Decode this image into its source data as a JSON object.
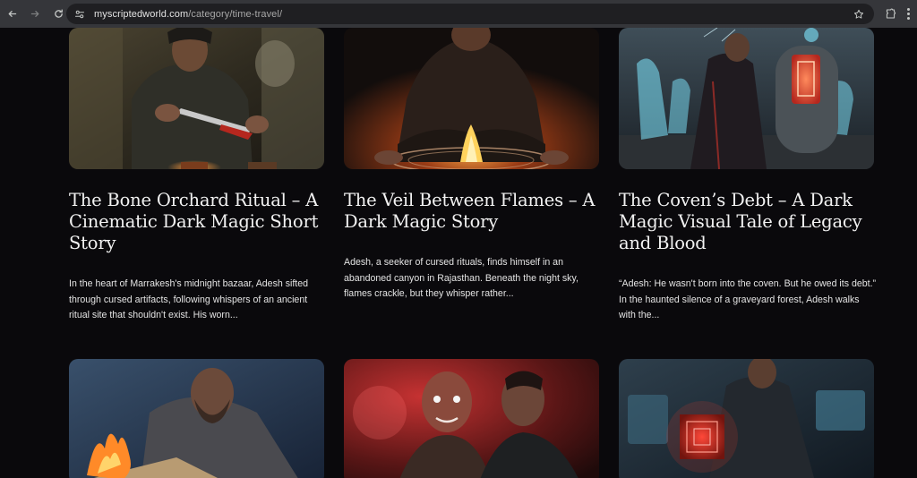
{
  "browser": {
    "url_domain": "myscriptedworld.com",
    "url_path": "/category/time-travel/",
    "icons": [
      "back-arrow-icon",
      "forward-arrow-icon",
      "reload-icon",
      "site-info-icon",
      "bookmark-star-icon",
      "extensions-icon",
      "menu-icon"
    ]
  },
  "posts": [
    {
      "title": "The Bone Orchard Ritual – A Cinematic Dark Magic Short Story",
      "excerpt": "In the heart of Marrakesh's midnight bazaar, Adesh sifted through cursed artifacts, following whispers of an ancient ritual site that shouldn't exist. His worn..."
    },
    {
      "title": "The Veil Between Flames – A Dark Magic Story",
      "excerpt": "Adesh, a seeker of cursed rituals, finds himself in an abandoned canyon in Rajasthan. Beneath the night sky, flames crackle, but they whisper rather..."
    },
    {
      "title": "The Coven’s Debt – A Dark Magic Visual Tale of Legacy and Blood",
      "excerpt": "“Adesh: He wasn't born into the coven. But he owed its debt.” In the haunted silence of a graveyard forest, Adesh walks with the..."
    }
  ],
  "colors": {
    "page_bg": "#0a090c",
    "toolbar_bg": "#35363a",
    "omnibox_bg": "#1f1f22",
    "title_text": "#f2f2f2",
    "body_text": "#e4e4e4"
  }
}
